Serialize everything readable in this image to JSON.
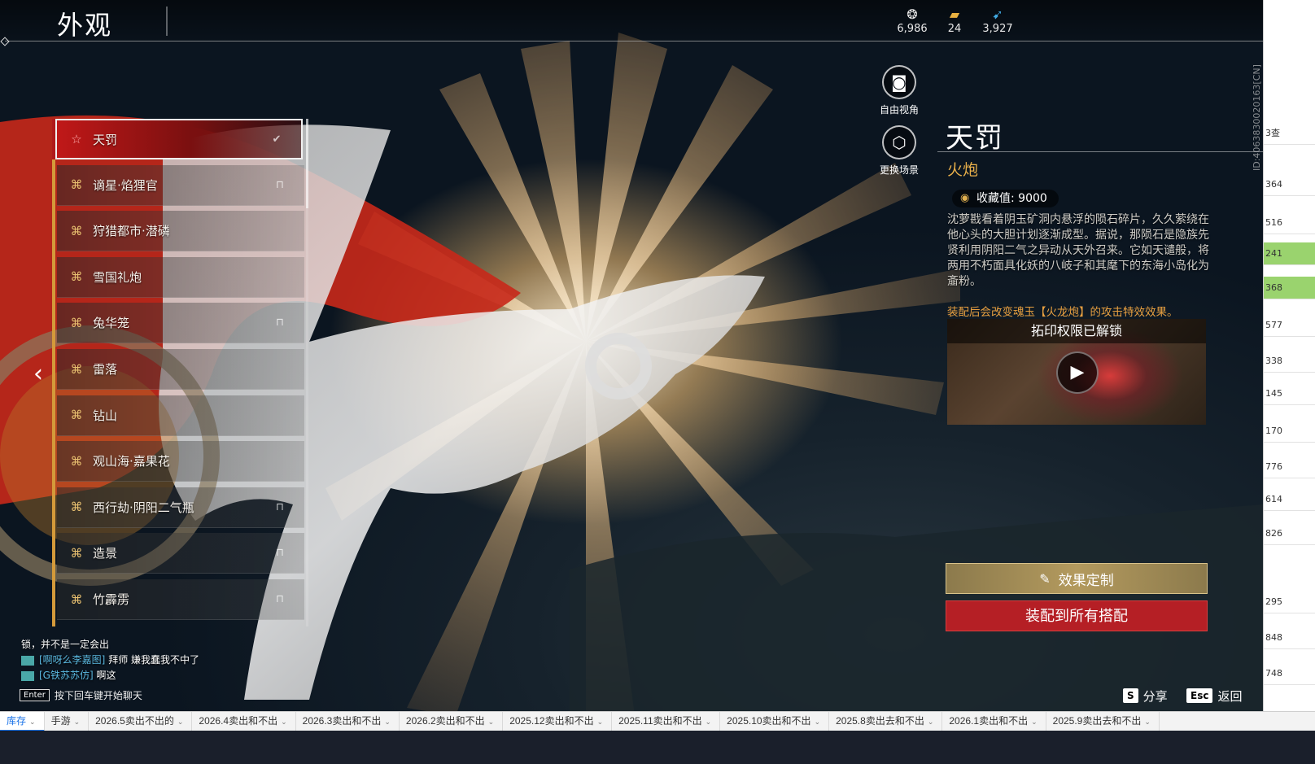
{
  "header": {
    "title": "外观",
    "currencies": [
      {
        "icon": "jade-currency-icon",
        "value": "6,986"
      },
      {
        "icon": "ticket-currency-icon",
        "value": "24"
      },
      {
        "icon": "feather-currency-icon",
        "value": "3,927"
      }
    ]
  },
  "view_buttons": [
    {
      "icon": "camera-icon",
      "label": "自由视角"
    },
    {
      "icon": "scene-icon",
      "label": "更换场景"
    }
  ],
  "items": [
    {
      "name": "天罚",
      "status": "equipped",
      "selected": true
    },
    {
      "name": "谪星·焰狸官",
      "status": "locked"
    },
    {
      "name": "狩猎都市·潜磷",
      "status": ""
    },
    {
      "name": "雪国礼炮",
      "status": ""
    },
    {
      "name": "兔华笼",
      "status": "locked"
    },
    {
      "name": "雷落",
      "status": ""
    },
    {
      "name": "钻山",
      "status": ""
    },
    {
      "name": "观山海·嘉果花",
      "status": ""
    },
    {
      "name": "西行劫·阴阳二气瓶",
      "status": "locked"
    },
    {
      "name": "造景",
      "status": "locked"
    },
    {
      "name": "竹霹雳",
      "status": "locked"
    }
  ],
  "detail": {
    "name": "天罚",
    "type": "火炮",
    "collection_label": "收藏值: 9000",
    "description": "沈萝戡看着阴玉矿洞内悬浮的陨石碎片，久久萦绕在他心头的大胆计划逐渐成型。据说，那陨石是隐族先贤利用阴阳二气之异动从天外召来。它如天谴般，将两用不朽面具化妖的八岐子和其麾下的东海小岛化为齑粉。",
    "effect_note": "装配后会改变魂玉【火龙炮】的攻击特效效果。",
    "video_title": "拓印权限已解锁",
    "customize_label": "效果定制",
    "equip_all_label": "装配到所有搭配"
  },
  "hints": {
    "share_key": "S",
    "share_label": "分享",
    "back_key": "Esc",
    "back_label": "返回"
  },
  "uid": "ID:4063830020163[CN]",
  "chat": {
    "lines": [
      {
        "who": "",
        "text": "锁，并不是一定会出"
      },
      {
        "who": "[啊呀么李嘉图]",
        "text": "拜师 嫌我蠢我不中了"
      },
      {
        "who": "[G铁苏苏仿]",
        "text": "啊这"
      }
    ],
    "input_key": "Enter",
    "input_hint": "按下回车键开始聊天"
  },
  "sheet_cells": [
    "3查",
    "364",
    "516",
    "241",
    "368",
    "577",
    "338",
    "145",
    "170",
    "776",
    "614",
    "826",
    "295",
    "848",
    "748"
  ],
  "tabs": [
    {
      "label": "库存",
      "active": true
    },
    {
      "label": "手游"
    },
    {
      "label": "2026.5卖出不出的"
    },
    {
      "label": "2026.4卖出和不出"
    },
    {
      "label": "2026.3卖出和不出"
    },
    {
      "label": "2026.2卖出和不出"
    },
    {
      "label": "2025.12卖出和不出"
    },
    {
      "label": "2025.11卖出和不出"
    },
    {
      "label": "2025.10卖出和不出"
    },
    {
      "label": "2025.8卖出去和不出"
    },
    {
      "label": "2026.1卖出和不出"
    },
    {
      "label": "2025.9卖出去和不出"
    }
  ],
  "colors": {
    "accent_red": "#b51f25",
    "gold": "#e9b04a",
    "tab_active": "#1a73e8"
  }
}
